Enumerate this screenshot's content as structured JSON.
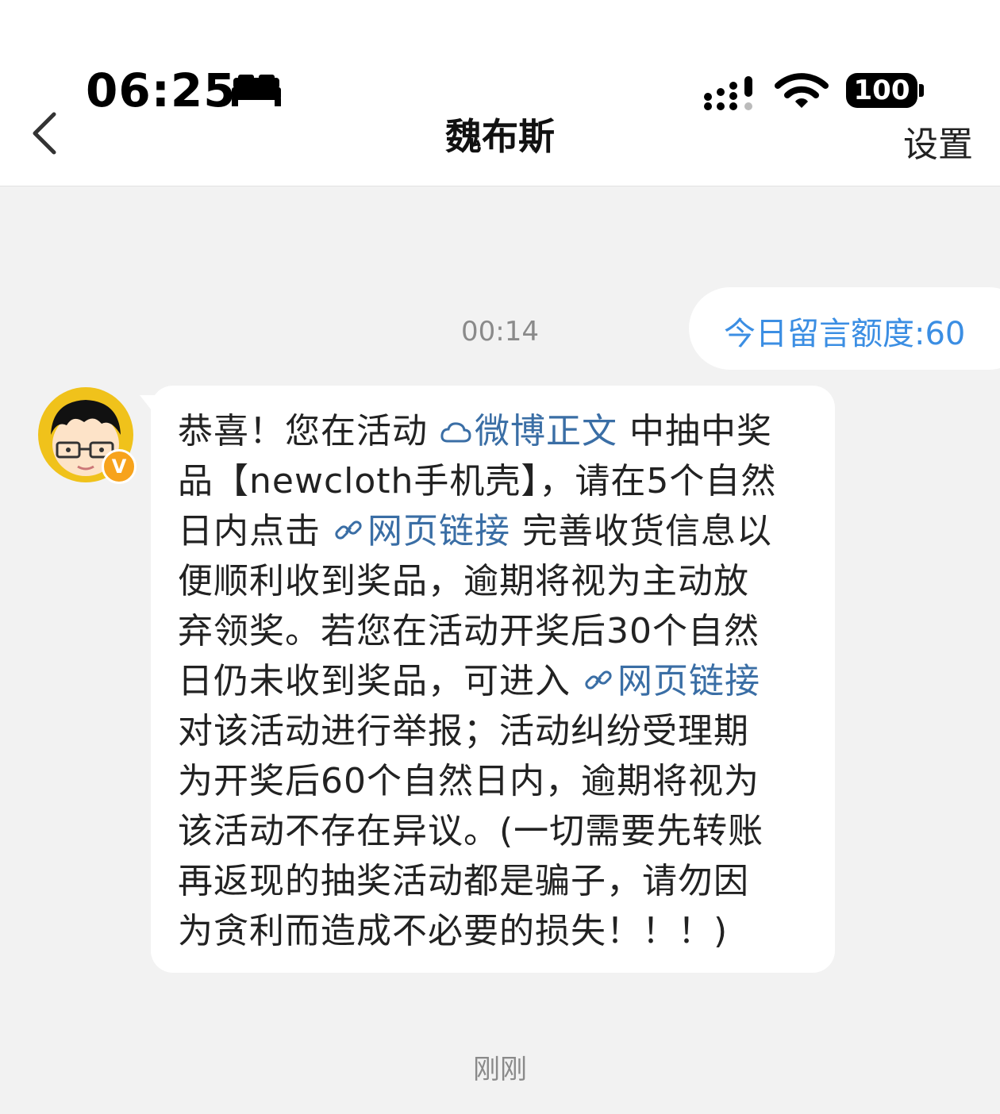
{
  "status_bar": {
    "time": "06:25",
    "battery": "100"
  },
  "nav": {
    "title": "魏布斯",
    "settings": "设置"
  },
  "quota": {
    "text": "今日留言额度:60"
  },
  "timestamps": {
    "first": "00:14",
    "last": "刚刚"
  },
  "sender": {
    "badge": "V"
  },
  "message": {
    "l1a": "恭喜！您在活动 ",
    "l1_link": "微博正文",
    "l1b": " 中抽中奖",
    "l2": "品【newcloth手机壳】，请在5个自然",
    "l3a": "日内点击 ",
    "l3_link": "网页链接",
    "l3b": " 完善收货信息以",
    "l4": "便顺利收到奖品，逾期将视为主动放",
    "l5": "弃领奖。若您在活动开奖后30个自然",
    "l6a": "日仍未收到奖品，可进入 ",
    "l6_link": "网页链接",
    "l7": "对该活动进行举报；活动纠纷受理期",
    "l8": "为开奖后60个自然日内，逾期将视为",
    "l9": "该活动不存在异议。(一切需要先转账",
    "l10": "再返现的抽奖活动都是骗子，请勿因",
    "l11": "为贪利而造成不必要的损失！！！)"
  },
  "colors": {
    "link": "#3a6ea5",
    "quota_text": "#3b8ee3",
    "badge": "#f7a31c"
  },
  "icons": [
    "bed-icon",
    "signal-icon",
    "wifi-icon",
    "battery-icon",
    "back-icon",
    "weibo-icon",
    "link-icon"
  ]
}
